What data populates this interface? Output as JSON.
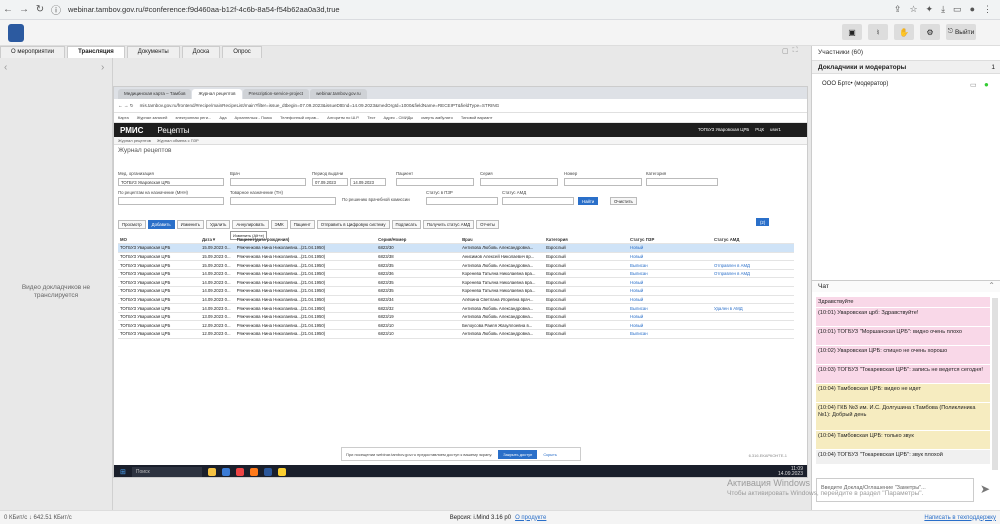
{
  "browser": {
    "url": "webinar.tambov.gov.ru/#conference:f9d460aa-b12f-4c6b-8a54-f54b62aa0a3d,true"
  },
  "webinar": {
    "tabs": [
      "О мероприятии",
      "Трансляция",
      "Документы",
      "Доска",
      "Опрос"
    ],
    "exit_label": "Выйти",
    "left_panel_text": "Видео докладчиков не транслируется",
    "participants_label": "Участники (60)",
    "speakers_header": "Докладчики и модераторы",
    "speakers_count": "1",
    "speaker_name": "ООО Бртс• (модератор)",
    "chat_label": "Чат",
    "chat_placeholder": "Введите Доклад/Оглашение \"Заметры\"...",
    "version": "Версия: i.Mind 3.16 p0",
    "version_link": "О продукте",
    "net_stats": "0 КБит/с   ↓ 642.51 КБит/с",
    "help_link": "Написать в техподдержку",
    "watermark_1": "Активация Windows",
    "watermark_2": "Чтобы активировать Windows, перейдите в раздел \"Параметры\"."
  },
  "inner": {
    "tabs": [
      "Медицинская карта – Тамбов",
      "Журнал рецептов",
      "Prescription-service-project",
      "webinar.tambov.gov.ru"
    ],
    "url": "mis.tambov.gov.ru/frontend/#recipe/mainRecipeList/main?filter=issue_dtbegin=07.09.2023&issueDtEnd=14.09.2023&medOrgId=1000&fieldName=RECEIPT&fieldType=STRING",
    "bookmarks": [
      "Карта",
      "Журнал записей",
      "электронная реги...",
      "Ада",
      "Архангельск - Поиск",
      "Телефонный справ...",
      "Алгоритм по Ш.Р.",
      "Тест",
      "Адрес - СМИДы",
      "смерть амбулато",
      "Типовой вариант"
    ],
    "app_name": "РМИС",
    "module": "Рецепты",
    "user_org": "ТОГБУЗ Уваровская ЦРБ",
    "user_menu": "РЦК",
    "user_name": "user1",
    "breadcrumb": [
      "Журнал рецептов",
      "Журнал обмена с ПЗР"
    ],
    "journal_title": "Журнал рецептов",
    "filters": {
      "med_org_label": "Мед. организация",
      "med_org_value": "ТОГБУЗ Уваровская ЦРБ",
      "doctor_label": "Врач",
      "period_label": "Период выдачи",
      "period_from": "07.09.2023",
      "period_to": "14.09.2023",
      "patient_label": "Пациент",
      "series_label": "Серия",
      "number_label": "Номер",
      "category_label": "Категория",
      "by_prescription_label": "По рецептам на назначение (МНН)",
      "trade_label": "Товарное назначение (ТН)",
      "status_pzr_label": "Статус в ПЗР",
      "status_amd_label": "Статус АМД",
      "by_decision_label": "По решению врачебной комиссии",
      "find_button": "Найти",
      "clear_button": "Очистить",
      "filter_count": "(2)"
    },
    "toolbar": [
      "Просмотр",
      "Добавить",
      "Изменить",
      "Удалить",
      "Аннулировать",
      "ЭМК",
      "Пациент",
      "Отправить в Цифровую систему",
      "Подписать",
      "Получить статус АМД",
      "Отчеты"
    ],
    "tooltip": "Изменить (Alt+e)",
    "columns": [
      "МО",
      "Дата▼",
      "Пациент(дата рождения)",
      "Серия/Номер",
      "Врач",
      "Категория",
      "Статус ПЗР",
      "Статус АМД"
    ],
    "rows": [
      [
        "ТОГБУЗ Уваровская ЦРБ",
        "15.09.2023 0...",
        "Ряжченкова Нина Николаевна...(21.04.1950)",
        "6823/30",
        "Антипова Любовь Александровна...",
        "Взрослый",
        "Новый",
        ""
      ],
      [
        "ТОГБУЗ Уваровская ЦРБ",
        "15.09.2023 0...",
        "Ряжченкова Нина Николаевна...(21.04.1950)",
        "6823/38",
        "Анисимов Алексей Николаевич вр...",
        "Взрослый",
        "Новый",
        ""
      ],
      [
        "ТОГБУЗ Уваровская ЦРБ",
        "15.09.2023 0...",
        "Ряжченкова Нина Николаевна...(21.04.1950)",
        "6823/35",
        "Антипова Любовь Александровна...",
        "Взрослый",
        "Выписан",
        "Отправлен в АМД"
      ],
      [
        "ТОГБУЗ Уваровская ЦРБ",
        "14.09.2023 0...",
        "Ряжченкова Нина Николаевна...(21.04.1950)",
        "6823/36",
        "Коренева Татьяна Николаевна вра...",
        "Взрослый",
        "Выписан",
        "Отправлен в АМД"
      ],
      [
        "ТОГБУЗ Уваровская ЦРБ",
        "14.09.2023 0...",
        "Ряжченкова Нина Николаевна...(21.04.1950)",
        "6823/35",
        "Коренева Татьяна Николаевна вра...",
        "Взрослый",
        "Новый",
        ""
      ],
      [
        "ТОГБУЗ Уваровская ЦРБ",
        "14.09.2023 0...",
        "Ряжченкова Нина Николаевна...(21.04.1950)",
        "6823/35",
        "Коренева Татьяна Николаевна вра...",
        "Взрослый",
        "Новый",
        ""
      ],
      [
        "ТОГБУЗ Уваровская ЦРБ",
        "14.09.2023 0...",
        "Ряжченкова Нина Николаевна...(21.04.1950)",
        "6823/34",
        "Алёхина Светлана Игоревна врач...",
        "Взрослый",
        "Новый",
        ""
      ],
      [
        "ТОГБУЗ Уваровская ЦРБ",
        "14.09.2023 0...",
        "Ряжченкова Нина Николаевна...(21.04.1950)",
        "6823/32",
        "Антипова Любовь Александровна...",
        "Взрослый",
        "Выписан",
        "Удален в АМД"
      ],
      [
        "ТОГБУЗ Уваровская ЦРБ",
        "13.09.2023 0...",
        "Ряжченкова Нина Николаевна...(21.04.1950)",
        "6823/19",
        "Антипова Любовь Александровна...",
        "Взрослый",
        "Новый",
        ""
      ],
      [
        "ТОГБУЗ Уваровская ЦРБ",
        "12.09.2023 0...",
        "Ряжченкова Нина Николаевна...(21.04.1950)",
        "6823/10",
        "Белоусова Раиля Жазуллоевна в...",
        "Взрослый",
        "Новый",
        ""
      ],
      [
        "ТОГБУЗ Уваровская ЦРБ",
        "12.09.2023 0...",
        "Ряжченкова Нина Николаевна...(21.04.1950)",
        "6823/10",
        "Антипова Любовь Александровна...",
        "Взрослый",
        "Выписан",
        ""
      ]
    ],
    "app_version": "6.316.ЕКАРКОНТЕ-1",
    "cookie_text": "При посещении webinar.tambov.gov.ru предоставляем доступ к вашему экрану.",
    "cookie_ok": "Закрыть доступ",
    "cookie_close": "Скрыть",
    "search_text": "Поиск",
    "tray_time": "11:09",
    "tray_date": "14.09.2023"
  },
  "chat": [
    {
      "text": "Здравствуйте",
      "color": "#f9d8e8"
    },
    {
      "text": "(10:01) Уваровская црб: Здравствуйте!",
      "color": "#f9d8e8"
    },
    {
      "text": "(10:01) ТОГБУЗ \"Моршанская ЦРБ\": видно очень плохо",
      "color": "#f9d8e8"
    },
    {
      "text": "(10:02) Уваровская ЦРБ: спицно не очень хорошо",
      "color": "#f9d8e8"
    },
    {
      "text": "(10:03) ТОГБУЗ \"Токаревская ЦРБ\": запись не ведется сегодня!",
      "color": "#f9d8e8"
    },
    {
      "text": "(10:04) Тамбовская ЦРБ: видео не идет",
      "color": "#f6ecc0"
    },
    {
      "text": "(10:04) ГКБ №3 им. И.С. Долгушина г.Тамбова (Поликлиника №1): Добрый день",
      "color": "#f6ecc0"
    },
    {
      "text": "(10:04) Тамбовская ЦРБ: только звук",
      "color": "#f6ecc0"
    },
    {
      "text": "(10:04) ТОГБУЗ \"Токаревская ЦРБ\": звук плохой",
      "color": "#f0f0f0"
    }
  ]
}
